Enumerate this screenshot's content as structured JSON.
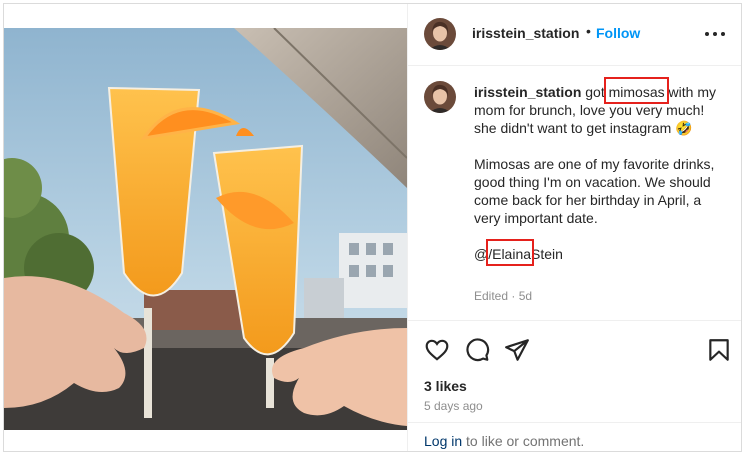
{
  "post": {
    "username": "irisstein_station",
    "separator": "•",
    "follow_label": "Follow",
    "more_icon": "more-horizontal-icon"
  },
  "caption": {
    "username": "irisstein_station",
    "line1_pre": "got ",
    "highlight_word": "mimosas",
    "line1_post": " with my mom for brunch, love you very much! she didn't want to get instagram",
    "emoji": "🤣",
    "paragraph2": "Mimosas are one of my favorite drinks, good thing I'm on vacation. We should come back for her birthday in April, a very important date.",
    "mention_at": "@",
    "mention_highlight": "/Elaina",
    "mention_rest": "Stein",
    "edited_label": "Edited",
    "edited_sep": " · ",
    "edited_time": "5d"
  },
  "actions": {
    "like_icon": "heart-icon",
    "comment_icon": "comment-icon",
    "share_icon": "send-icon",
    "save_icon": "bookmark-icon",
    "likes_text": "3 likes",
    "time_ago": "5 days ago"
  },
  "login": {
    "link_text": "Log in",
    "rest_text": " to like or comment."
  },
  "colors": {
    "accent": "#0095f6",
    "highlight_box": "#e5211c",
    "muted": "#8e8e8e",
    "link_dark": "#00376b"
  }
}
